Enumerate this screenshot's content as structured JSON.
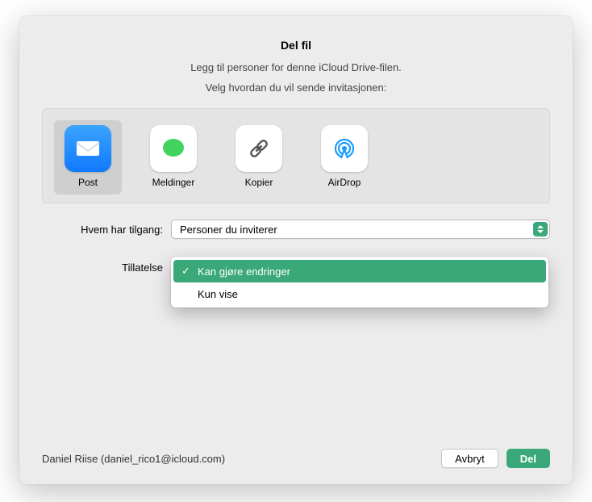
{
  "title": "Del fil",
  "subtitle": "Legg til personer for denne iCloud Drive-filen.",
  "subtitle2": "Velg hvordan du vil sende invitasjonen:",
  "methods": [
    {
      "id": "mail",
      "label": "Post",
      "selected": true
    },
    {
      "id": "messages",
      "label": "Meldinger",
      "selected": false
    },
    {
      "id": "copy",
      "label": "Kopier",
      "selected": false
    },
    {
      "id": "airdrop",
      "label": "AirDrop",
      "selected": false
    }
  ],
  "access": {
    "label": "Hvem har tilgang:",
    "value": "Personer du inviterer"
  },
  "permission": {
    "label": "Tillatelse",
    "options": [
      {
        "label": "Kan gjøre endringer",
        "selected": true
      },
      {
        "label": "Kun vise",
        "selected": false
      }
    ]
  },
  "user": "Daniel Riise (daniel_rico1@icloud.com)",
  "buttons": {
    "cancel": "Avbryt",
    "share": "Del"
  },
  "colors": {
    "accent": "#3aa879"
  }
}
